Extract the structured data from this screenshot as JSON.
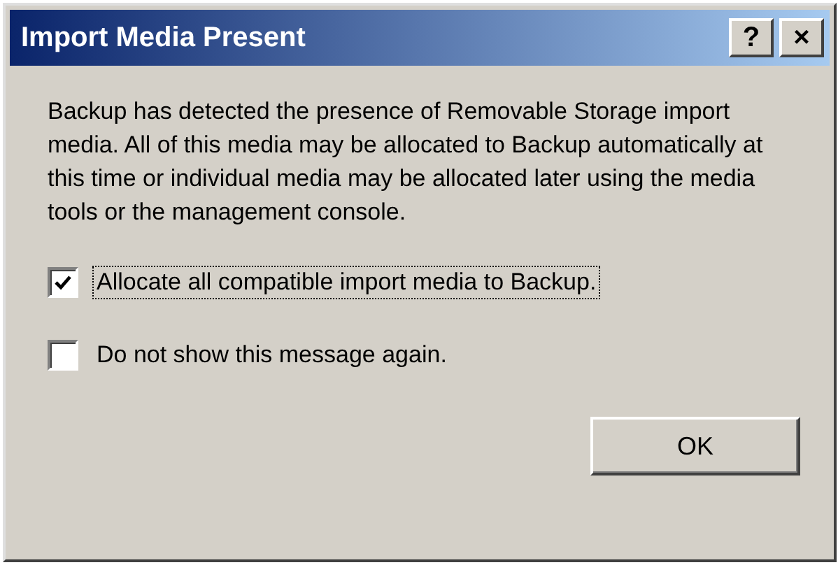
{
  "window": {
    "title": "Import Media Present",
    "title_buttons": [
      "?",
      "×"
    ]
  },
  "message": "Backup has detected the presence of Removable Storage import media.  All of this media may be allocated to Backup automatically at this time or individual media may be allocated later using the media tools or the management console.",
  "options": [
    {
      "label": "Allocate all compatible import media to Backup.",
      "checked": true,
      "focused": true
    },
    {
      "label": "Do not show this message again.",
      "checked": false,
      "focused": false
    }
  ],
  "buttons": [
    "OK"
  ]
}
